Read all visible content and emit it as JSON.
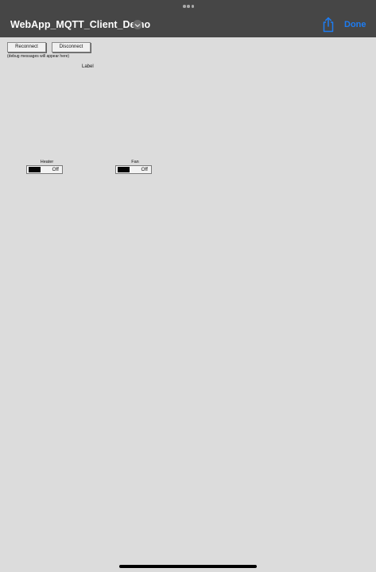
{
  "header": {
    "title": "WebApp_MQTT_Client_Demo",
    "done_label": "Done",
    "title_chevron_icon": "chevron-down-icon",
    "share_icon": "share-icon",
    "accent_color": "#1d7cf2"
  },
  "controls": {
    "reconnect_label": "Reconnect",
    "disconnect_label": "Disconnect",
    "debug_text": "(debug messages will appear here)",
    "label_text": "Label"
  },
  "toggles": [
    {
      "title": "Heater",
      "state": "Off"
    },
    {
      "title": "Fan",
      "state": "Off"
    }
  ]
}
